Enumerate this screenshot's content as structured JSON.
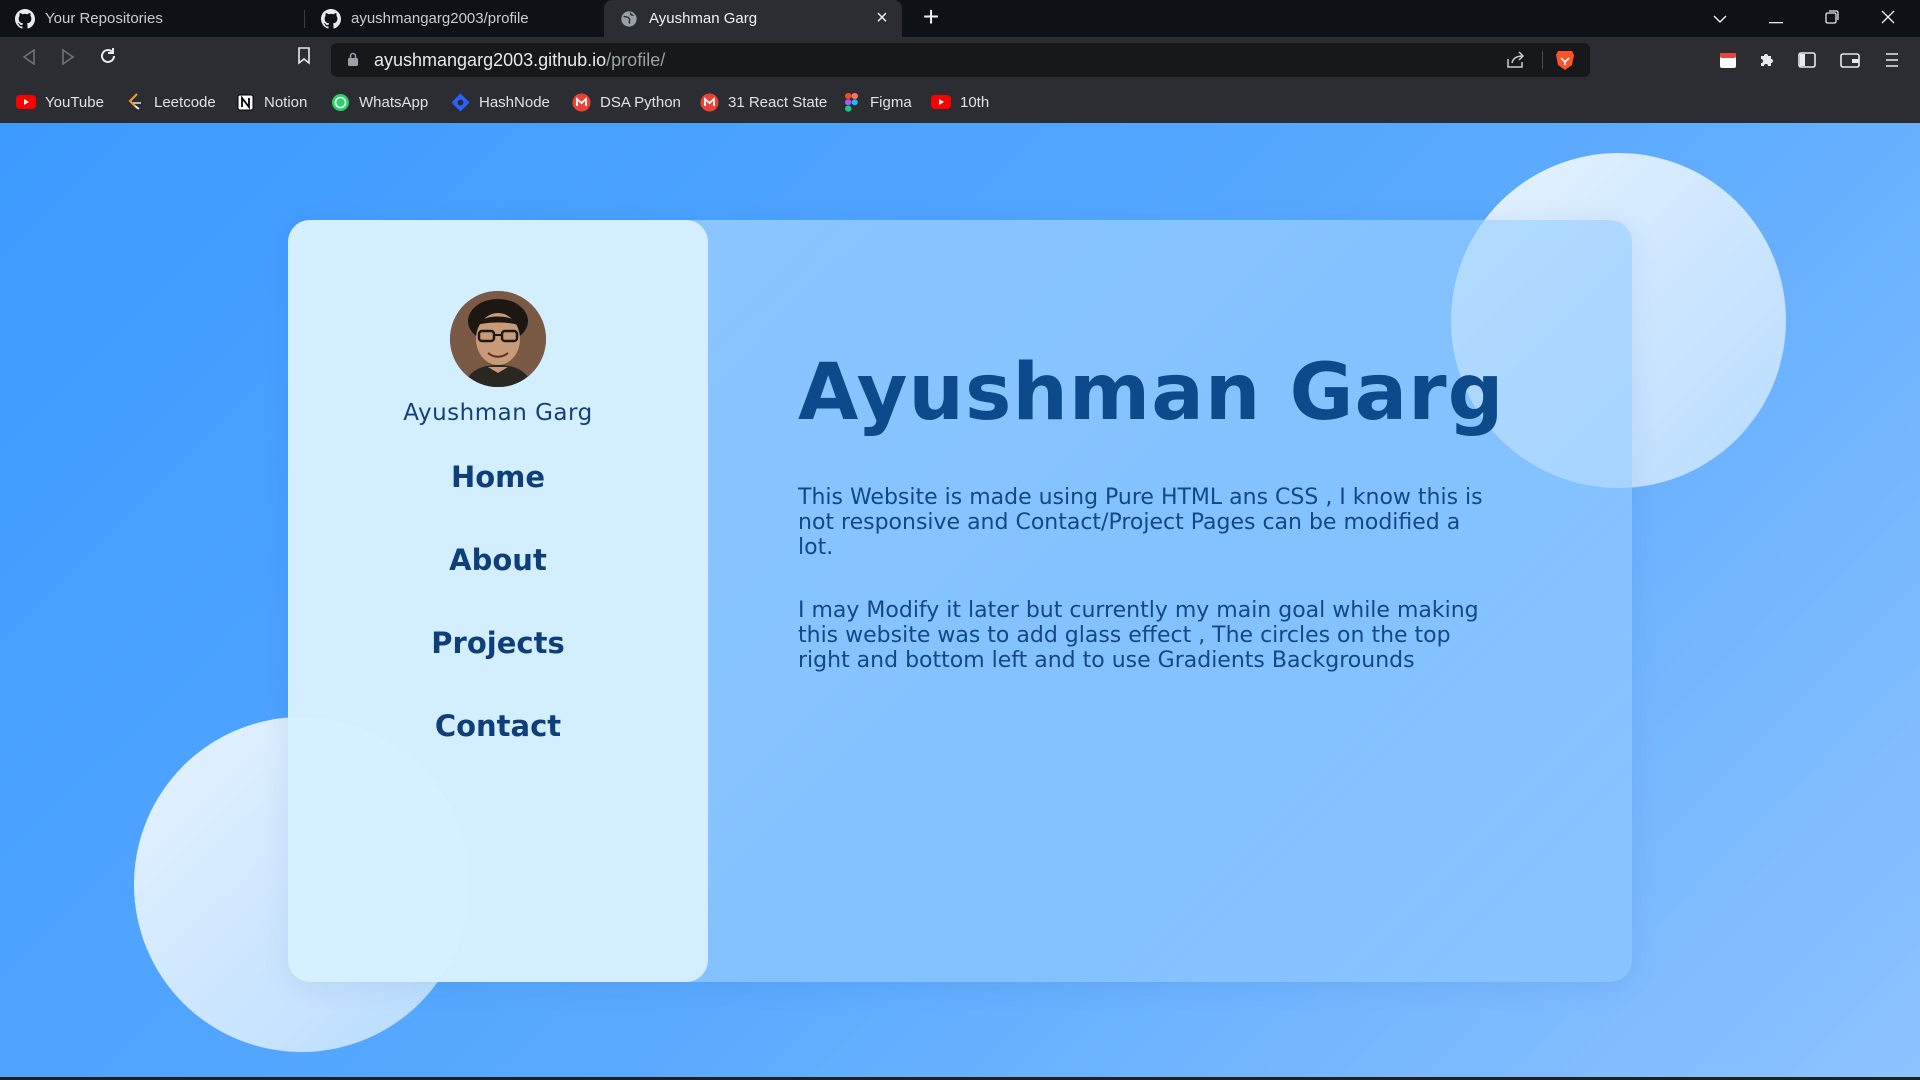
{
  "browser": {
    "tabs": [
      {
        "title": "Your Repositories",
        "icon": "github-icon"
      },
      {
        "title": "ayushmangarg2003/profile",
        "icon": "github-icon"
      },
      {
        "title": "Ayushman Garg",
        "icon": "globe-icon",
        "active": true
      }
    ],
    "url": {
      "host": "ayushmangarg2003.github.io",
      "path": "/profile/"
    },
    "bookmarks": [
      {
        "label": "YouTube",
        "icon": "youtube-icon",
        "color": "#ff0000"
      },
      {
        "label": "Leetcode",
        "icon": "leetcode-icon",
        "color": "#f89f1b"
      },
      {
        "label": "Notion",
        "icon": "notion-icon",
        "color": "#ffffff"
      },
      {
        "label": "WhatsApp",
        "icon": "whatsapp-icon",
        "color": "#25d366"
      },
      {
        "label": "HashNode",
        "icon": "hashnode-icon",
        "color": "#2962ff"
      },
      {
        "label": "DSA Python",
        "icon": "gmail-icon",
        "color": "#ea4335"
      },
      {
        "label": "31 React State",
        "icon": "gmail-icon",
        "color": "#ea4335"
      },
      {
        "label": "Figma",
        "icon": "figma-icon",
        "color": "#f24e1e"
      },
      {
        "label": "10th",
        "icon": "youtube-icon",
        "color": "#ff0000"
      }
    ]
  },
  "profile": {
    "name": "Ayushman Garg",
    "nav": [
      "Home",
      "About",
      "Projects",
      "Contact"
    ],
    "heading": "Ayushman Garg",
    "paragraphs": [
      "This Website is made using Pure HTML ans CSS , I know this is not responsive and Contact/Project Pages can be modified a lot.",
      "I may Modify it later but currently my main goal while making this website was to add glass effect , The circles on the top right and bottom left and to use Gradients Backgrounds"
    ]
  },
  "colors": {
    "accent": "#0c4a8c",
    "background": "#3d9aff",
    "sidebar": "#d6f0ff"
  }
}
